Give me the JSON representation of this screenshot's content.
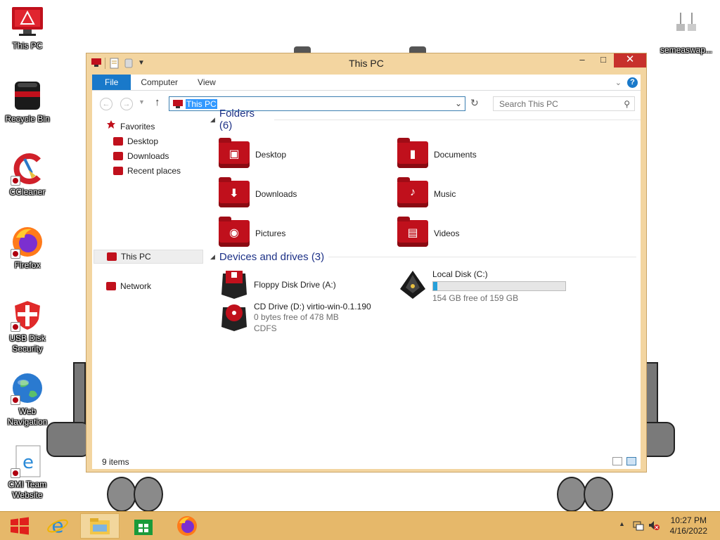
{
  "desktop": {
    "icons": [
      {
        "label": "This PC"
      },
      {
        "label": "Recycle Bin"
      },
      {
        "label": "CCleaner"
      },
      {
        "label": "Firefox"
      },
      {
        "label": "USB Disk Security"
      },
      {
        "label": "Web Navigation"
      },
      {
        "label": "CMI Team Website"
      },
      {
        "label": "semeaswap..."
      }
    ]
  },
  "window": {
    "title": "This PC",
    "ribbon_tabs": [
      "File",
      "Computer",
      "View"
    ],
    "address": "This PC",
    "search_placeholder": "Search This PC",
    "nav": {
      "favorites": "Favorites",
      "desktop": "Desktop",
      "downloads": "Downloads",
      "recent": "Recent places",
      "this_pc": "This PC",
      "network": "Network"
    },
    "folders_header": "Folders (6)",
    "folders": [
      {
        "name": "Desktop"
      },
      {
        "name": "Documents"
      },
      {
        "name": "Downloads"
      },
      {
        "name": "Music"
      },
      {
        "name": "Pictures"
      },
      {
        "name": "Videos"
      }
    ],
    "devices_header": "Devices and drives (3)",
    "devices": {
      "floppy": {
        "name": "Floppy Disk Drive (A:)"
      },
      "local": {
        "name": "Local Disk (C:)",
        "free_text": "154 GB free of 159 GB",
        "used_fraction": 0.031
      },
      "cd": {
        "name": "CD Drive (D:) virtio-win-0.1.190",
        "free_text": "0 bytes free of 478 MB",
        "fs": "CDFS"
      }
    },
    "status": "9 items"
  },
  "taskbar": {
    "time": "10:27 PM",
    "date": "4/16/2022"
  },
  "colors": {
    "accent": "#1979ca",
    "theme_red": "#c0101c",
    "window_frame": "#f3d5a0",
    "taskbar": "#e6b86a"
  }
}
